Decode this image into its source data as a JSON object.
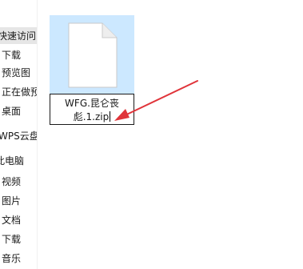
{
  "nav": {
    "items": [
      {
        "label": "快速访问",
        "icon": "star-icon"
      },
      {
        "label": "下载",
        "icon": "download-icon"
      },
      {
        "label": "预览图",
        "icon": "folder-icon"
      },
      {
        "label": "正在做预",
        "icon": "folder-icon"
      },
      {
        "label": "桌面",
        "icon": "desktop-icon"
      },
      {
        "label": "WPS云盘",
        "icon": "cloud-icon"
      },
      {
        "label": "此电脑",
        "icon": "computer-icon"
      },
      {
        "label": "视频",
        "icon": "video-icon"
      },
      {
        "label": "图片",
        "icon": "picture-icon"
      },
      {
        "label": "文档",
        "icon": "document-icon"
      },
      {
        "label": "下载",
        "icon": "download-icon"
      },
      {
        "label": "音乐",
        "icon": "music-icon"
      }
    ]
  },
  "file": {
    "name_line1": "WFG.昆仑丧",
    "name_line2": "彪.1.zip",
    "selected_color": "#cce8ff"
  },
  "annotation": {
    "arrow_color": "#e0343a"
  }
}
